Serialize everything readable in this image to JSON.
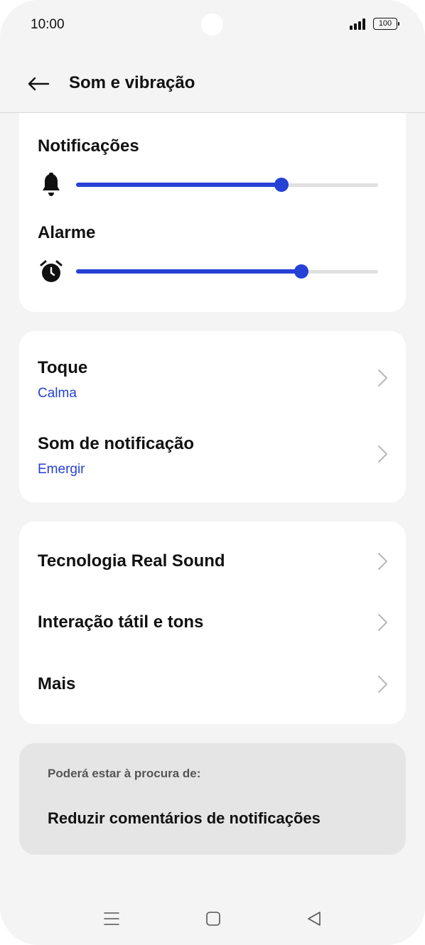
{
  "status_bar": {
    "time": "10:00",
    "battery": "100",
    "icons": [
      "signal-icon",
      "battery-icon"
    ]
  },
  "header": {
    "title": "Som e vibração",
    "back_icon": "arrow-left-icon"
  },
  "volume": {
    "notifications": {
      "label": "Notificações",
      "icon": "bell-icon",
      "level": 0.68
    },
    "alarm": {
      "label": "Alarme",
      "icon": "alarm-clock-icon",
      "level": 0.745
    }
  },
  "sounds": [
    {
      "title": "Toque",
      "value": "Calma"
    },
    {
      "title": "Som de notificação",
      "value": "Emergir"
    }
  ],
  "more": [
    {
      "title": "Tecnologia Real Sound"
    },
    {
      "title": "Interação tátil e tons"
    },
    {
      "title": "Mais"
    }
  ],
  "suggestions": {
    "label": "Poderá estar à procura de:",
    "items": [
      "Reduzir comentários de notificações"
    ]
  },
  "nav": [
    "menu-icon",
    "home-icon",
    "back-triangle-icon"
  ],
  "colors": {
    "accent": "#2541d6",
    "background": "#f4f4f4",
    "card": "#ffffff",
    "suggestion_card": "#e5e5e5"
  }
}
